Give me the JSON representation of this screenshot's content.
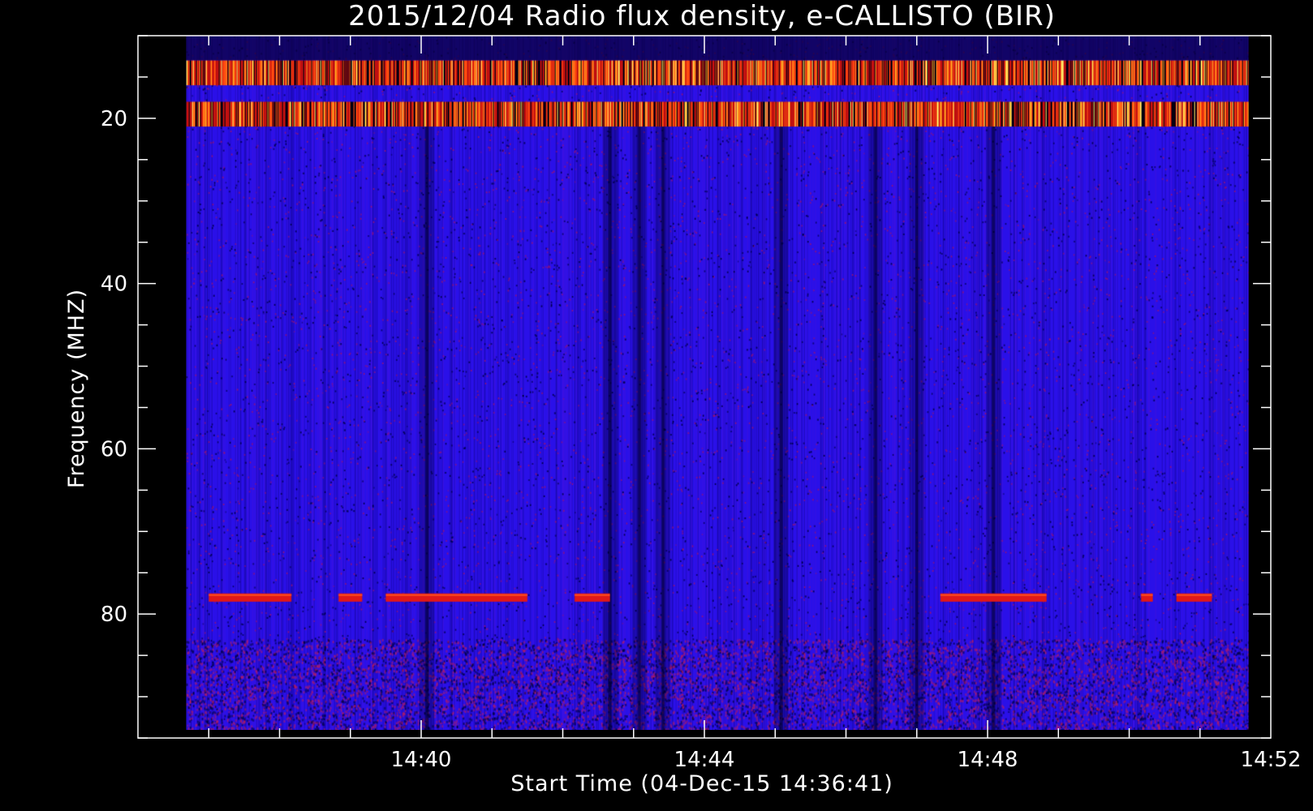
{
  "chart_data": {
    "type": "heatmap",
    "title": "2015/12/04  Radio flux density, e-CALLISTO (BIR)",
    "xlabel": "Start Time (04-Dec-15 14:36:41)",
    "ylabel": "Frequency (MHZ)",
    "x_start": "14:36:41",
    "x_end": "14:51:41",
    "xlim": [
      "14:36:00",
      "14:52:00"
    ],
    "ylim": [
      95,
      10
    ],
    "y_data_range": [
      10,
      94
    ],
    "x_ticks": [
      "14:40",
      "14:44",
      "14:48",
      "14:52"
    ],
    "y_ticks": [
      "20",
      "40",
      "60",
      "80"
    ],
    "colormap": "black-blue-red-yellow",
    "features": [
      {
        "kind": "horizontal_band",
        "freq_mhz": [
          13,
          16
        ],
        "intensity": "high"
      },
      {
        "kind": "horizontal_band",
        "freq_mhz": [
          18,
          21
        ],
        "intensity": "high"
      },
      {
        "kind": "horizontal_band",
        "freq_mhz": [
          77.5,
          78.5
        ],
        "intensity": "medium",
        "intervals": [
          [
            "14:37:00",
            "14:38:10"
          ],
          [
            "14:38:50",
            "14:39:10"
          ],
          [
            "14:39:30",
            "14:41:30"
          ],
          [
            "14:42:10",
            "14:42:40"
          ],
          [
            "14:47:20",
            "14:48:50"
          ],
          [
            "14:50:10",
            "14:50:20"
          ],
          [
            "14:50:40",
            "14:51:10"
          ]
        ]
      },
      {
        "kind": "vertical_dark_lanes",
        "times": [
          "14:40:05",
          "14:42:40",
          "14:43:05",
          "14:43:25",
          "14:45:05",
          "14:46:25",
          "14:47:00",
          "14:48:05"
        ]
      }
    ]
  }
}
